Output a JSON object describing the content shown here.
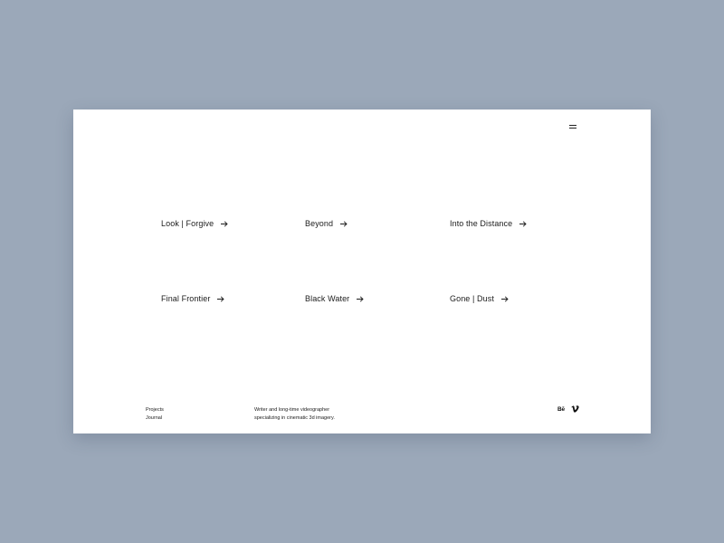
{
  "header": {
    "menu_icon": "hamburger-icon"
  },
  "projects": [
    {
      "label": "Look | Forgive",
      "icon": "arrow-right-icon"
    },
    {
      "label": "Beyond",
      "icon": "arrow-right-icon"
    },
    {
      "label": "Into the Distance",
      "icon": "arrow-right-icon"
    },
    {
      "label": "Final Frontier",
      "icon": "arrow-right-icon"
    },
    {
      "label": "Black Water",
      "icon": "arrow-right-icon"
    },
    {
      "label": "Gone | Dust",
      "icon": "arrow-right-icon"
    }
  ],
  "footer": {
    "nav": [
      "Projects",
      "Journal"
    ],
    "tagline_line1": "Writer and long-time videographer",
    "tagline_line2": "specializing in cinematic 3d imagery.",
    "social": {
      "behance_label": "Bē",
      "vimeo_icon": "vimeo-icon"
    }
  },
  "colors": {
    "background": "#9ba8b9",
    "card": "#ffffff",
    "text": "#1a1a1a"
  }
}
